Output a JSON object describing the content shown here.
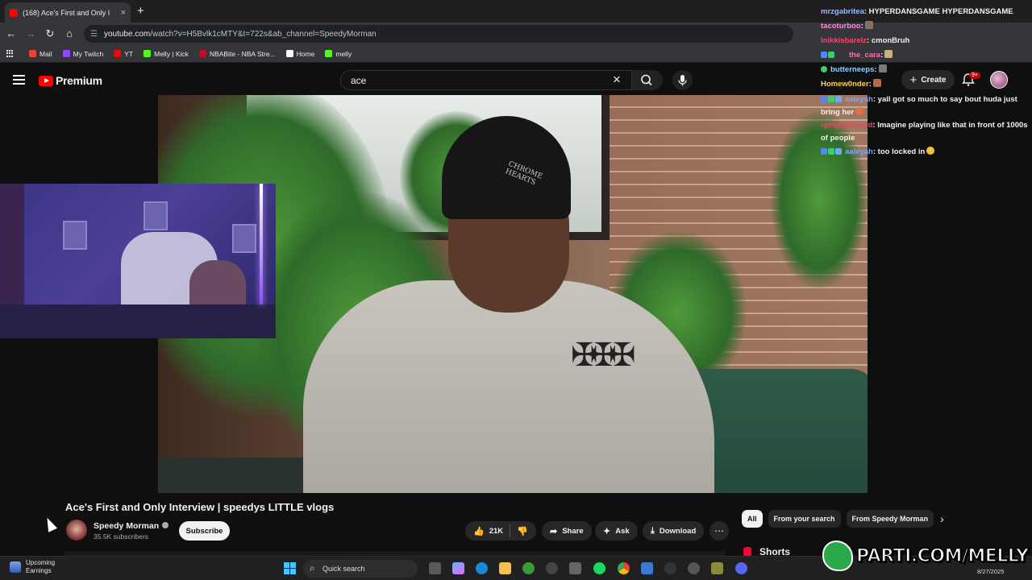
{
  "browser": {
    "tab_title": "(168) Ace's First and Only I",
    "new_tab": "+",
    "url_host": "youtube.com",
    "url_path": "/watch?v=H5Bvlk1cMTY&t=722s&ab_channel=SpeedyMorman",
    "bookmarks": [
      {
        "label": "Mail",
        "color": "#ea4335"
      },
      {
        "label": "My Twitch",
        "color": "#9146ff"
      },
      {
        "label": "YT",
        "color": "#ff0000"
      },
      {
        "label": "Melly | Kick",
        "color": "#53fc18"
      },
      {
        "label": "NBABite - NBA Stre...",
        "color": "#c9082a"
      },
      {
        "label": "Home",
        "color": "#ffffff"
      },
      {
        "label": "melly",
        "color": "#53fc18"
      }
    ]
  },
  "youtube": {
    "logo_text": "Premium",
    "search_value": "ace",
    "create_label": "Create",
    "notif_badge": "9+"
  },
  "chat": [
    {
      "user": "mrzgabritea",
      "user_color": "#a0b8ff",
      "msg": ": HYPERDANSGAME HYPERDANSGAME"
    },
    {
      "user": "tacoturboo",
      "user_color": "#ff8ad8",
      "msg": ":"
    },
    {
      "user": "lnikkisbarelz",
      "user_color": "#ff4466",
      "msg": ": cmonBruh"
    },
    {
      "user": "the_cara",
      "user_color": "#ff6fb4",
      "msg": ":"
    },
    {
      "user": "butterneeps",
      "user_color": "#8fd0ff",
      "msg": ":"
    },
    {
      "user": "Homew0nder",
      "user_color": "#ffd34a",
      "msg": ":"
    },
    {
      "user": "aaleyah",
      "user_color": "#6fa8ff",
      "msg": ": yall got so much to say bout huda just bring her"
    },
    {
      "user": "lgirlgymbaayd",
      "user_color": "#ff3a6a",
      "msg": ": Imagine playing like that in front of 1000s of people"
    },
    {
      "user": "aaleyah",
      "user_color": "#6fa8ff",
      "msg": ": too locked in"
    }
  ],
  "video": {
    "title": "Ace's First and Only Interview | speedys LITTLE vlogs",
    "channel": "Speedy Morman",
    "subscribers": "35.5K subscribers",
    "subscribe_label": "Subscribe",
    "likes": "21K",
    "share_label": "Share",
    "ask_label": "Ask",
    "download_label": "Download",
    "beanie_text": "CHROME HEARTS"
  },
  "sidebar": {
    "chips": [
      "All",
      "From your search",
      "From Speedy Morman"
    ],
    "shorts_label": "Shorts"
  },
  "taskbar": {
    "weather_title": "Upcoming",
    "weather_sub": "Earnings",
    "search_placeholder": "Quick search",
    "date": "8/27/2025"
  },
  "branding": {
    "text": "PARTI.COM/MELLY"
  }
}
